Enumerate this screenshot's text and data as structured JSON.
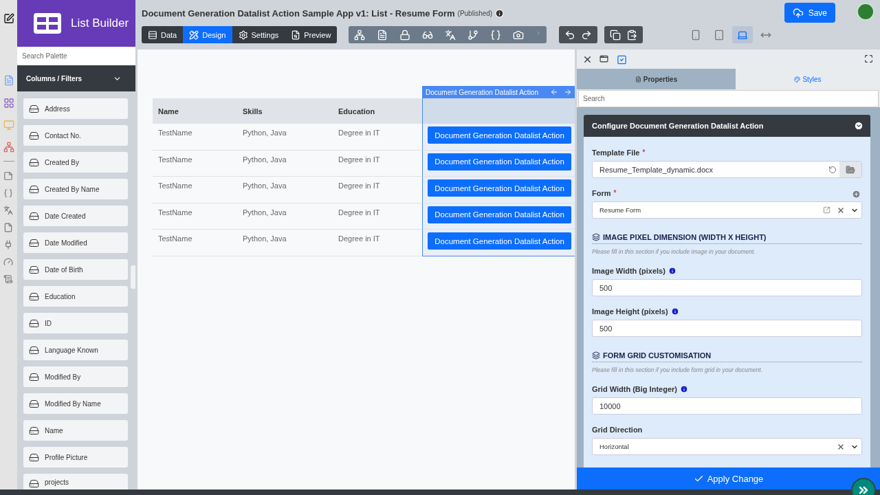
{
  "app": {
    "title": "List Builder"
  },
  "palette": {
    "search_placeholder": "Search Palette",
    "section": {
      "label": "Columns / Filters",
      "expanded": true
    },
    "items": [
      "Address",
      "Contact No.",
      "Created By",
      "Created By Name",
      "Date Created",
      "Date Modified",
      "Date of Birth",
      "Education",
      "ID",
      "Language Known",
      "Modified By",
      "Modified By Name",
      "Name",
      "Profile Picture",
      "projects"
    ]
  },
  "header": {
    "title": "Document Generation Datalist Action Sample App v1: List - Resume Form",
    "status": "(Published)",
    "save": "Save"
  },
  "mode_tabs": [
    {
      "label": "Data",
      "kind": "data",
      "selected": false
    },
    {
      "label": "Design",
      "kind": "design",
      "selected": true
    },
    {
      "label": "Settings",
      "kind": "settings",
      "selected": false
    },
    {
      "label": "Preview",
      "kind": "preview",
      "selected": false
    }
  ],
  "device_buttons": [
    {
      "kind": "phone",
      "selected": false
    },
    {
      "kind": "tablet",
      "selected": false
    },
    {
      "kind": "laptop",
      "selected": true
    },
    {
      "kind": "fit",
      "selected": false
    }
  ],
  "table": {
    "columns": [
      "Name",
      "Skills",
      "Education"
    ],
    "action_column": "Document Generation Datalist Action",
    "rows": [
      {
        "cells": [
          "TestName",
          "Python, Java",
          "Degree in IT"
        ],
        "action": "Document Generation Datalist Action"
      },
      {
        "cells": [
          "TestName",
          "Python, Java",
          "Degree in IT"
        ],
        "action": "Document Generation Datalist Action"
      },
      {
        "cells": [
          "TestName",
          "Python, Java",
          "Degree in IT"
        ],
        "action": "Document Generation Datalist Action"
      },
      {
        "cells": [
          "TestName",
          "Python, Java",
          "Degree in IT"
        ],
        "action": "Document Generation Datalist Action"
      },
      {
        "cells": [
          "TestName",
          "Python, Java",
          "Degree in IT"
        ],
        "action": "Document Generation Datalist Action"
      }
    ]
  },
  "panel": {
    "tabs": [
      {
        "label": "Properties",
        "kind": "properties",
        "selected": true
      },
      {
        "label": "Styles",
        "kind": "styles",
        "selected": false
      }
    ],
    "search_placeholder": "Search",
    "section_title": "Configure Document Generation Datalist Action",
    "fields": [
      {
        "kind": "file",
        "label": "Template File",
        "required_mark": "*",
        "value": "Resume_Template_dynamic.docx"
      },
      {
        "kind": "select",
        "label": "Form",
        "required_mark": "*",
        "value": "Resume Form",
        "editable": true,
        "addable": true
      },
      {
        "kind": "heading",
        "label": "IMAGE PIXEL DIMENSION (WIDTH X HEIGHT)",
        "note": "Please fill in this section if you include image in your document."
      },
      {
        "kind": "text",
        "label": "Image Width (pixels)",
        "info": true,
        "value": "500"
      },
      {
        "kind": "text",
        "label": "Image Height (pixels)",
        "info": true,
        "value": "500"
      },
      {
        "kind": "heading",
        "label": "FORM GRID CUSTOMISATION",
        "note": "Please fill in this section if you include form grid in your document."
      },
      {
        "kind": "text",
        "label": "Grid Width (Big Integer)",
        "info": true,
        "value": "10000"
      },
      {
        "kind": "select",
        "label": "Grid Direction",
        "value": "Horizontal"
      }
    ],
    "apply": "Apply Change"
  }
}
